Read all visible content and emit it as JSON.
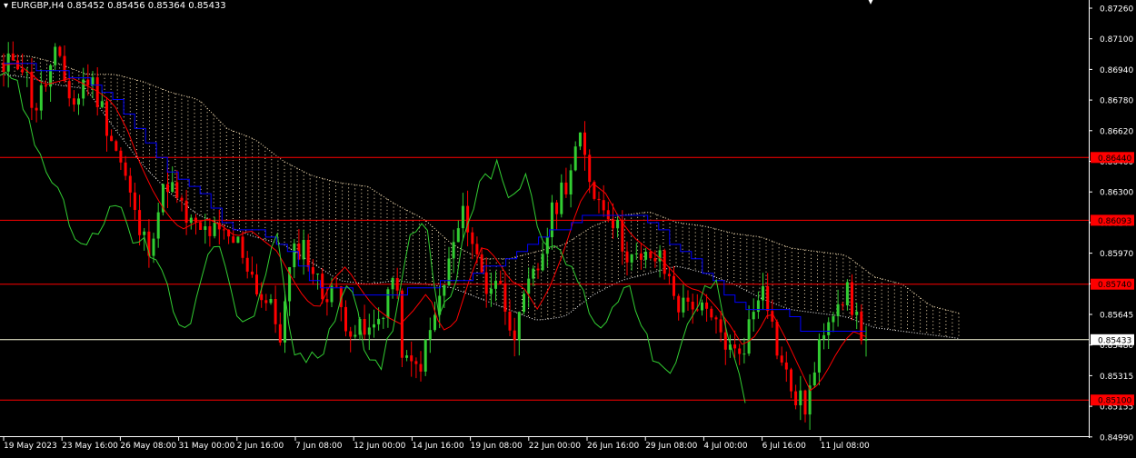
{
  "header": {
    "symbol_line": "EURGBP,H4",
    "ohlc_line": "0.85452 0.85456 0.85364 0.85433"
  },
  "colors": {
    "background": "#000000",
    "bull_candle": "#32CD32",
    "bear_candle": "#FF0000",
    "tenkan": "#FF0000",
    "kijun": "#0000FF",
    "chikou": "#32CD32",
    "cloud_a": "#FFFFFF",
    "cloud_b": "#F5DEB3",
    "level_line": "#FF0000",
    "current_price_line": "#FFFFE0",
    "axis_text": "#FFFFFF"
  },
  "chart_data": {
    "type": "candlestick",
    "symbol": "EURGBP",
    "timeframe": "H4",
    "ylim": [
      0.849,
      0.8731
    ],
    "y_ticks": [
      "0.87260",
      "0.87100",
      "0.86940",
      "0.86780",
      "0.86620",
      "0.86460",
      "0.86300",
      "0.86140",
      "0.85970",
      "0.85810",
      "0.85645",
      "0.85480",
      "0.85315",
      "0.85155",
      "0.84990"
    ],
    "x_ticks": [
      "19 May 2023",
      "23 May 16:00",
      "26 May 08:00",
      "31 May 00:00",
      "2 Jun 16:00",
      "7 Jun 08:00",
      "12 Jun 00:00",
      "14 Jun 16:00",
      "19 Jun 08:00",
      "22 Jun 00:00",
      "26 Jun 16:00",
      "29 Jun 08:00",
      "4 Jul 00:00",
      "6 Jul 16:00",
      "11 Jul 08:00"
    ],
    "price_levels": [
      {
        "value": 0.8644,
        "label": "0.86440"
      },
      {
        "value": 0.86093,
        "label": "0.86093"
      },
      {
        "value": 0.8574,
        "label": "0.85740"
      },
      {
        "value": 0.851,
        "label": "0.85100"
      }
    ],
    "current_price": {
      "value": 0.85433,
      "label": "0.85433"
    },
    "last_bar": {
      "open": 0.85452,
      "high": 0.85456,
      "low": 0.85364,
      "close": 0.85433
    },
    "close_path": [
      0.8689,
      0.8702,
      0.8694,
      0.867,
      0.8684,
      0.87,
      0.8685,
      0.8672,
      0.869,
      0.868,
      0.8664,
      0.8648,
      0.863,
      0.8606,
      0.8594,
      0.8614,
      0.8632,
      0.8618,
      0.8608,
      0.8602,
      0.8604,
      0.86,
      0.8598,
      0.8596,
      0.8582,
      0.8568,
      0.856,
      0.8546,
      0.8586,
      0.8598,
      0.8584,
      0.8568,
      0.8574,
      0.8558,
      0.855,
      0.8546,
      0.8548,
      0.8562,
      0.858,
      0.853,
      0.8526,
      0.8536,
      0.8556,
      0.8576,
      0.86,
      0.8614,
      0.859,
      0.8572,
      0.8578,
      0.856,
      0.8546,
      0.857,
      0.8582,
      0.8604,
      0.8622,
      0.8634,
      0.8654,
      0.8634,
      0.862,
      0.8616,
      0.86,
      0.859,
      0.8584,
      0.859,
      0.8586,
      0.8574,
      0.856,
      0.8566,
      0.8558,
      0.8552,
      0.8546,
      0.8534,
      0.854,
      0.8558,
      0.858,
      0.8546,
      0.8526,
      0.8512,
      0.8506,
      0.8524,
      0.8554,
      0.8566,
      0.857,
      0.8556,
      0.8543
    ],
    "tenkan_path": [
      0.8695,
      0.8696,
      0.869,
      0.8684,
      0.8686,
      0.8688,
      0.8684,
      0.868,
      0.8674,
      0.866,
      0.864,
      0.8624,
      0.8612,
      0.8604,
      0.8608,
      0.861,
      0.8606,
      0.86,
      0.8604,
      0.8598,
      0.8592,
      0.8578,
      0.8566,
      0.856,
      0.8576,
      0.8584,
      0.8572,
      0.8562,
      0.8556,
      0.8552,
      0.856,
      0.857,
      0.8548,
      0.8552,
      0.8576,
      0.8596,
      0.8588,
      0.8576,
      0.8572,
      0.856,
      0.8574,
      0.8594,
      0.8618,
      0.863,
      0.8624,
      0.861,
      0.86,
      0.8594,
      0.8588,
      0.858,
      0.8572,
      0.857,
      0.8562,
      0.8552,
      0.854,
      0.8546,
      0.856,
      0.8546,
      0.853,
      0.8514,
      0.8524,
      0.8538,
      0.8548,
      0.8545
    ],
    "kijun_path": [
      0.8695,
      0.8695,
      0.869,
      0.869,
      0.8688,
      0.868,
      0.8668,
      0.865,
      0.8636,
      0.863,
      0.8618,
      0.8604,
      0.8604,
      0.86,
      0.859,
      0.8574,
      0.8572,
      0.857,
      0.8568,
      0.8568,
      0.8572,
      0.8574,
      0.8574,
      0.858,
      0.8586,
      0.8592,
      0.86,
      0.8604,
      0.861,
      0.8612,
      0.8614,
      0.8612,
      0.8602,
      0.8592,
      0.858,
      0.857,
      0.8562,
      0.8558,
      0.8558,
      0.8546,
      0.8546,
      0.8546,
      0.8546
    ],
    "chikou_path": [
      0.8686,
      0.869,
      0.866,
      0.864,
      0.863,
      0.86,
      0.8594,
      0.8608,
      0.862,
      0.86,
      0.8596,
      0.858,
      0.856,
      0.8546,
      0.8586,
      0.8598,
      0.856,
      0.855,
      0.8576,
      0.86,
      0.854,
      0.853,
      0.8536,
      0.856,
      0.858,
      0.853,
      0.8526,
      0.8556,
      0.86,
      0.8614,
      0.856,
      0.8572,
      0.861,
      0.863,
      0.864,
      0.8622,
      0.8634,
      0.8604,
      0.859,
      0.8586,
      0.8566,
      0.855,
      0.856,
      0.858,
      0.8546,
      0.853,
      0.852,
      0.855,
      0.8566,
      0.858,
      0.854,
      0.8512
    ],
    "cloud_upper": [
      0.87,
      0.87,
      0.8696,
      0.869,
      0.869,
      0.8686,
      0.868,
      0.8676,
      0.866,
      0.8654,
      0.8642,
      0.8634,
      0.863,
      0.8628,
      0.8618,
      0.861,
      0.8596,
      0.8588,
      0.8588,
      0.8592,
      0.8596,
      0.8606,
      0.8612,
      0.8614,
      0.8608,
      0.8606,
      0.8602,
      0.86,
      0.8594,
      0.8592,
      0.859,
      0.8578,
      0.8574,
      0.8562,
      0.8558
    ],
    "cloud_lower": [
      0.869,
      0.8688,
      0.8684,
      0.8682,
      0.866,
      0.864,
      0.8624,
      0.8612,
      0.8606,
      0.86,
      0.8596,
      0.8586,
      0.8576,
      0.8574,
      0.8576,
      0.8574,
      0.8572,
      0.8566,
      0.856,
      0.8554,
      0.8556,
      0.8568,
      0.8576,
      0.858,
      0.8584,
      0.858,
      0.8574,
      0.8566,
      0.856,
      0.8558,
      0.8556,
      0.855,
      0.8548,
      0.8546,
      0.8544
    ]
  }
}
